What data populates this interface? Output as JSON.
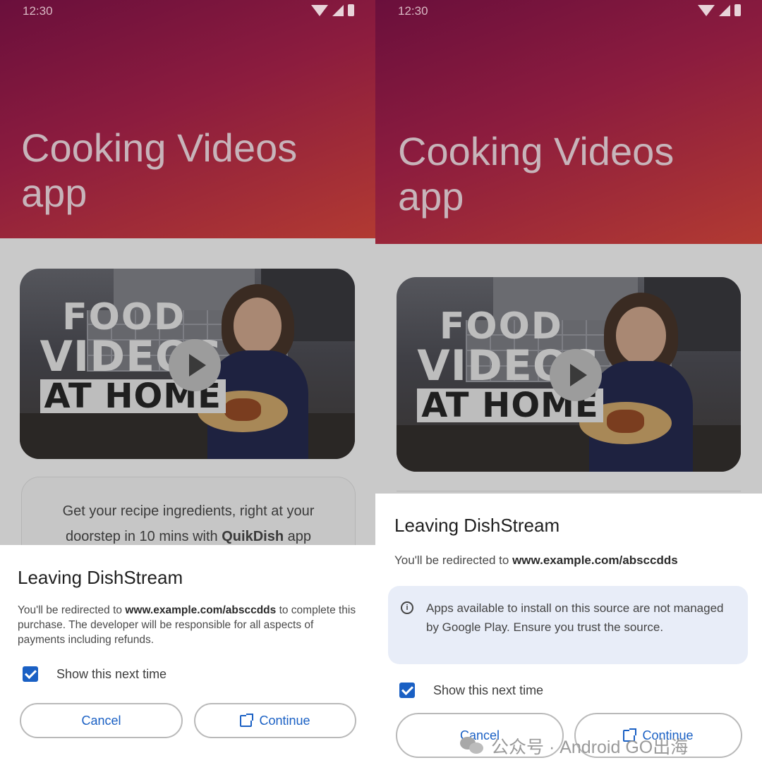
{
  "screens": [
    {
      "status": {
        "time": "12:30"
      },
      "hero": {
        "title": "Cooking Videos app"
      },
      "video": {
        "text_line1": "FOOD",
        "text_line2": "VIDEOS",
        "text_line3": "AT HOME"
      },
      "promo": {
        "text_before": "Get your recipe ingredients, right at your doorstep in 10 mins with ",
        "brand": "QuikDish",
        "text_after": " app"
      },
      "sheet": {
        "title": "Leaving DishStream",
        "body_prefix": "You'll be redirected to ",
        "url": "www.example.com/absccdds",
        "body_suffix": " to complete this purchase. The developer will be responsible for all aspects of payments including refunds.",
        "checkbox_label": "Show this next time",
        "checkbox_checked": true,
        "cancel_label": "Cancel",
        "continue_label": "Continue"
      }
    },
    {
      "status": {
        "time": "12:30"
      },
      "hero": {
        "title": "Cooking Videos app"
      },
      "video": {
        "text_line1": "FOOD",
        "text_line2": "VIDEOS",
        "text_line3": "AT HOME"
      },
      "sheet": {
        "title": "Leaving DishStream",
        "body_prefix": "You'll be redirected to ",
        "url": "www.example.com/absccdds",
        "info_text": "Apps available to install on this source are not managed by Google Play. Ensure you trust the source.",
        "checkbox_label": "Show this next time",
        "checkbox_checked": true,
        "cancel_label": "Cancel",
        "continue_label": "Continue"
      }
    }
  ],
  "watermark": {
    "text": "公众号 · Android GO出海"
  },
  "colors": {
    "accent": "#1a60c4",
    "hero_start": "#6a0f3c",
    "hero_end": "#b23a32"
  }
}
